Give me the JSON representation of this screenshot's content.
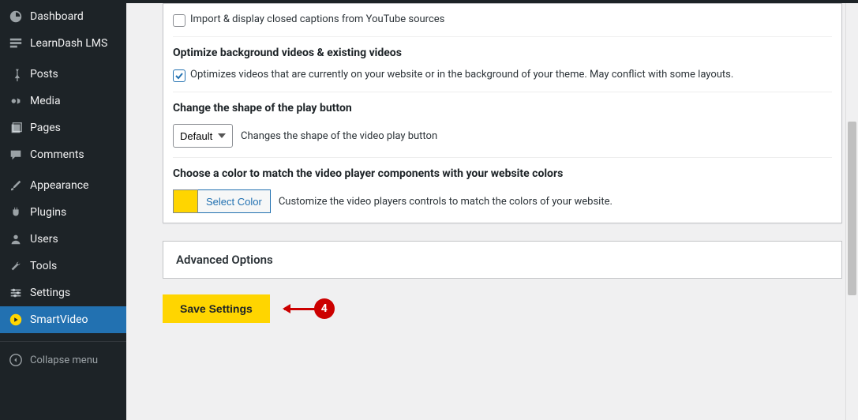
{
  "sidebar": {
    "items": [
      {
        "label": "Dashboard",
        "icon": "dashboard-icon"
      },
      {
        "label": "LearnDash LMS",
        "icon": "learndash-icon"
      },
      {
        "label": "Posts",
        "icon": "pin-icon"
      },
      {
        "label": "Media",
        "icon": "media-icon"
      },
      {
        "label": "Pages",
        "icon": "page-icon"
      },
      {
        "label": "Comments",
        "icon": "comment-icon"
      },
      {
        "label": "Appearance",
        "icon": "brush-icon"
      },
      {
        "label": "Plugins",
        "icon": "plugin-icon"
      },
      {
        "label": "Users",
        "icon": "user-icon"
      },
      {
        "label": "Tools",
        "icon": "wrench-icon"
      },
      {
        "label": "Settings",
        "icon": "settings-icon"
      },
      {
        "label": "SmartVideo",
        "icon": "smartvideo-icon"
      }
    ],
    "collapse_label": "Collapse menu"
  },
  "settings": {
    "captions_label": "Import & display closed captions from YouTube sources",
    "optimize_title": "Optimize background videos & existing videos",
    "optimize_label": "Optimizes videos that are currently on your website or in the background of your theme. May conflict with some layouts.",
    "shape_title": "Change the shape of the play button",
    "shape_select": "Default",
    "shape_desc": "Changes the shape of the video play button",
    "color_title": "Choose a color to match the video player components with your website colors",
    "color_btn": "Select Color",
    "color_desc": "Customize the video players controls to match the colors of your website.",
    "color_hex": "#ffd500"
  },
  "advanced_title": "Advanced Options",
  "save_label": "Save Settings",
  "annotation_number": "4"
}
